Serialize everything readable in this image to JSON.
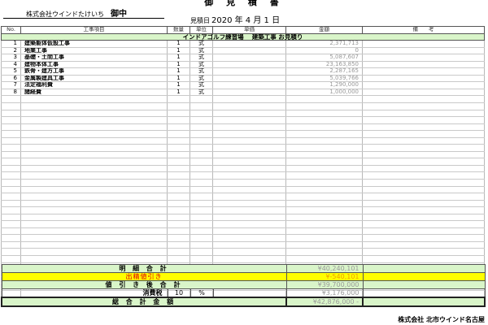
{
  "header": {
    "title": "御 見 積 書",
    "client_name": "株式会社ウインドたけいち",
    "client_honorific": "御中",
    "date_label": "見積日",
    "date_value": "2020 年 4 月 1 日"
  },
  "table": {
    "columns": [
      "No.",
      "工事項目",
      "数量",
      "単位",
      "単価",
      "金額",
      "備　　考"
    ],
    "project_title": "インドアゴルフ練習場　 建築工事 お見積り",
    "rows": [
      {
        "no": "1",
        "item": "建築躯体仮設工事",
        "qty": "1",
        "unit": "式",
        "price": "",
        "amount": "2,371,713",
        "note": ""
      },
      {
        "no": "2",
        "item": "地業工事",
        "qty": "1",
        "unit": "式",
        "price": "",
        "amount": "0",
        "note": ""
      },
      {
        "no": "3",
        "item": "基礎・土間工事",
        "qty": "1",
        "unit": "式",
        "price": "",
        "amount": "5,087,607",
        "note": ""
      },
      {
        "no": "4",
        "item": "建物本体工事",
        "qty": "1",
        "unit": "式",
        "price": "",
        "amount": "23,163,850",
        "note": ""
      },
      {
        "no": "5",
        "item": "鉄骨・建方工事",
        "qty": "1",
        "unit": "式",
        "price": "",
        "amount": "2,287,165",
        "note": ""
      },
      {
        "no": "6",
        "item": "金属製建具工事",
        "qty": "1",
        "unit": "式",
        "price": "",
        "amount": "5,039,766",
        "note": ""
      },
      {
        "no": "7",
        "item": "法定福利費",
        "qty": "1",
        "unit": "式",
        "price": "",
        "amount": "1,290,000",
        "note": ""
      },
      {
        "no": "8",
        "item": "諸経費",
        "qty": "1",
        "unit": "式",
        "price": "",
        "amount": "1,000,000",
        "note": ""
      }
    ]
  },
  "summary": {
    "detail_total_label": "明 細 合 計",
    "detail_total_amount": "¥40,240,101",
    "discount_label": "出精値引き",
    "discount_amount": "¥-540,101",
    "after_discount_label": "値 引 き 後 合 計",
    "after_discount_amount": "¥39,700,000",
    "tax_label": "消費税",
    "tax_rate": "10",
    "tax_unit": "%",
    "tax_amount": "¥3,176,000",
    "grand_total_label": "総 合 計 金 額",
    "grand_total_amount": "¥42,876,000 -"
  },
  "footer": {
    "company": "株式会社 北市ウインド名古屋"
  }
}
